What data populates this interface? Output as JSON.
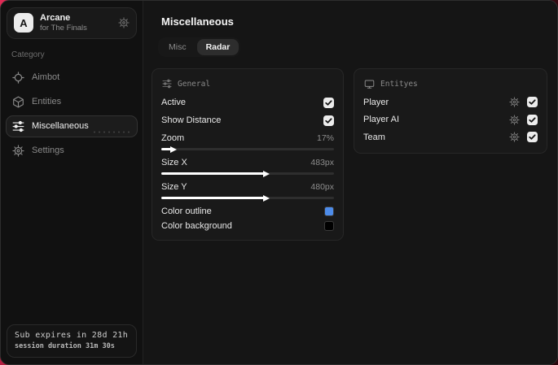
{
  "accent": {
    "brand_red": "#d62a52",
    "outline_blue": "#4d8cea"
  },
  "sidebar": {
    "app": {
      "logo_letter": "A",
      "name": "Arcane",
      "subtitle": "for The Finals"
    },
    "category_label": "Category",
    "items": [
      {
        "label": "Aimbot",
        "icon": "crosshair-icon",
        "active": false
      },
      {
        "label": "Entities",
        "icon": "cube-icon",
        "active": false
      },
      {
        "label": "Miscellaneous",
        "icon": "sliders-icon",
        "active": true
      },
      {
        "label": "Settings",
        "icon": "gear-icon",
        "active": false
      }
    ],
    "status": {
      "line1": "Sub expires in 28d 21h",
      "line2": "session duration 31m 30s"
    }
  },
  "main": {
    "title": "Miscellaneous",
    "tabs": [
      {
        "label": "Misc",
        "active": false
      },
      {
        "label": "Radar",
        "active": true
      }
    ],
    "general": {
      "title": "General",
      "toggles": [
        {
          "label": "Active",
          "checked": true
        },
        {
          "label": "Show Distance",
          "checked": true
        }
      ],
      "sliders": [
        {
          "label": "Zoom",
          "value": "17%",
          "percent": 6
        },
        {
          "label": "Size X",
          "value": "483px",
          "percent": 60
        },
        {
          "label": "Size Y",
          "value": "480px",
          "percent": 60
        }
      ],
      "colors": [
        {
          "label": "Color outline",
          "color": "#4d8cea"
        },
        {
          "label": "Color background",
          "color": "#000000"
        }
      ]
    },
    "entities": {
      "title": "Entityes",
      "rows": [
        {
          "label": "Player",
          "checked": true
        },
        {
          "label": "Player AI",
          "checked": true
        },
        {
          "label": "Team",
          "checked": true
        }
      ]
    }
  }
}
